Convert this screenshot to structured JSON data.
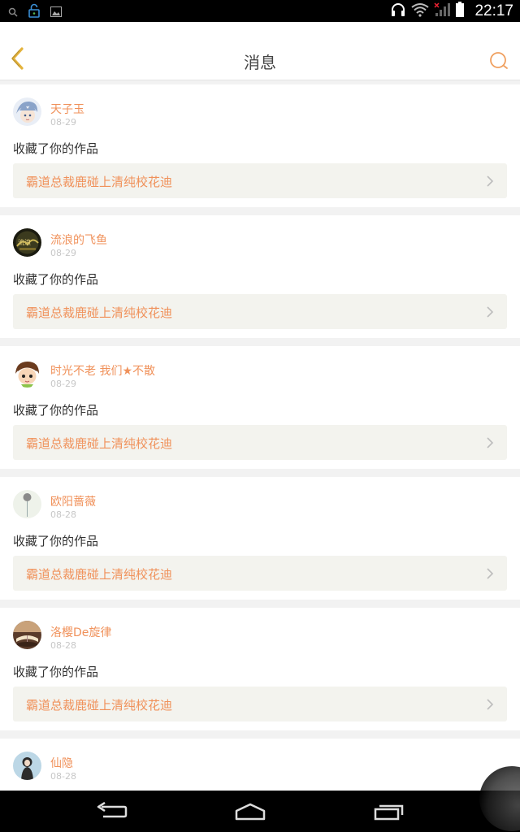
{
  "status_bar": {
    "time": "22:17",
    "icons": [
      "search-icon",
      "lock-icon",
      "image-icon",
      "headphones-icon",
      "wifi-icon",
      "signal-icon",
      "battery-icon"
    ]
  },
  "header": {
    "title": "消息",
    "back_icon": "chevron-left-icon",
    "search_icon": "search-icon",
    "accent_color": "#f0915a"
  },
  "messages": [
    {
      "name": "天子玉",
      "date": "08-29",
      "action": "收藏了你的作品",
      "work": "霸道总裁鹿碰上清纯校花迪"
    },
    {
      "name": "流浪的飞鱼",
      "date": "08-29",
      "action": "收藏了你的作品",
      "work": "霸道总裁鹿碰上清纯校花迪"
    },
    {
      "name": "时光不老 我们★不散",
      "date": "08-29",
      "action": "收藏了你的作品",
      "work": "霸道总裁鹿碰上清纯校花迪"
    },
    {
      "name": "欧阳蔷薇",
      "date": "08-28",
      "action": "收藏了你的作品",
      "work": "霸道总裁鹿碰上清纯校花迪"
    },
    {
      "name": "洛樱De旋律",
      "date": "08-28",
      "action": "收藏了你的作品",
      "work": "霸道总裁鹿碰上清纯校花迪"
    },
    {
      "name": "仙隐",
      "date": "08-28"
    }
  ],
  "nav_bar": {
    "icons": [
      "back-icon",
      "home-icon",
      "recent-apps-icon"
    ]
  }
}
